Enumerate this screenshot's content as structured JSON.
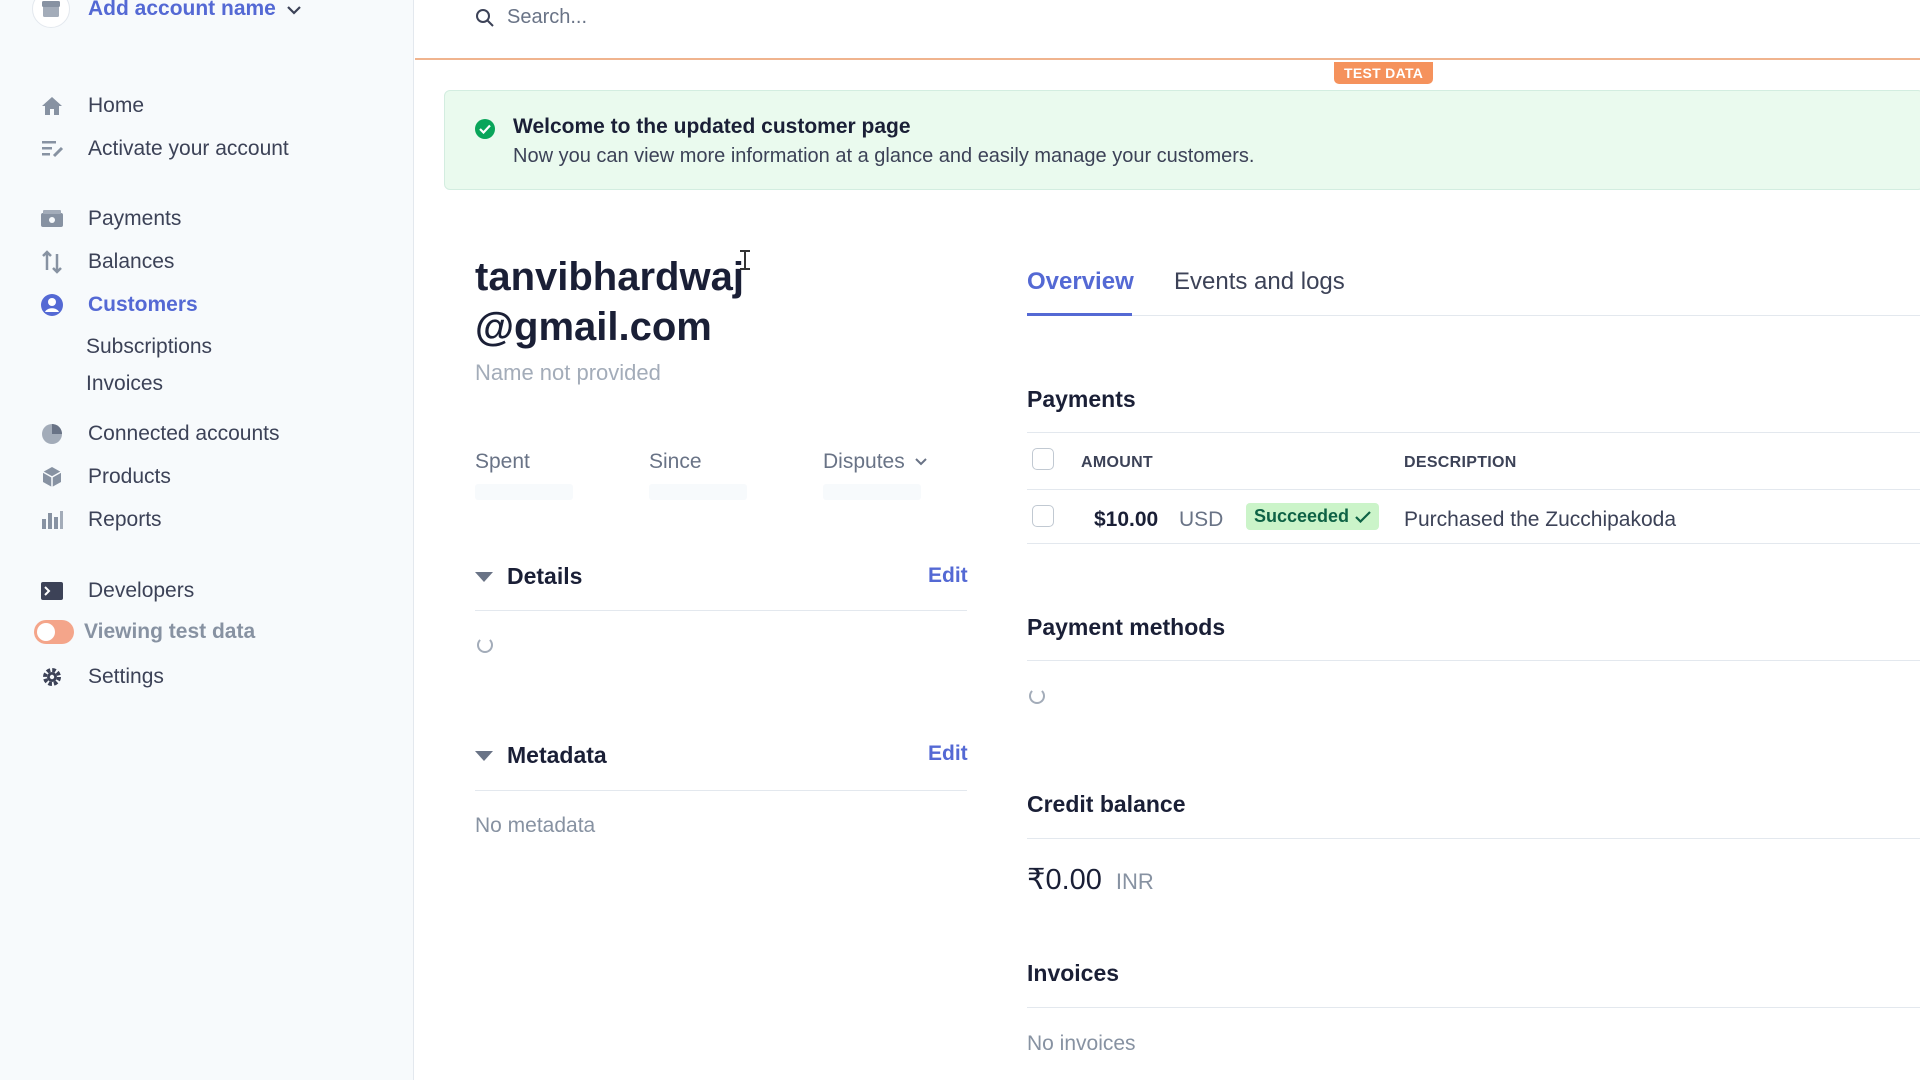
{
  "sidebar": {
    "account_name": "Add account name",
    "items": [
      {
        "label": "Home",
        "icon": "home-icon"
      },
      {
        "label": "Activate your account",
        "icon": "checklist-icon"
      },
      {
        "label": "Payments",
        "icon": "payments-icon"
      },
      {
        "label": "Balances",
        "icon": "balances-icon"
      },
      {
        "label": "Customers",
        "icon": "customers-icon",
        "active": true
      },
      {
        "label": "Subscriptions"
      },
      {
        "label": "Invoices"
      },
      {
        "label": "Connected accounts",
        "icon": "connected-accounts-icon"
      },
      {
        "label": "Products",
        "icon": "products-icon"
      },
      {
        "label": "Reports",
        "icon": "reports-icon"
      },
      {
        "label": "Developers",
        "icon": "terminal-icon"
      },
      {
        "label": "Viewing test data",
        "icon": "toggle-icon"
      },
      {
        "label": "Settings",
        "icon": "gear-icon"
      }
    ]
  },
  "search": {
    "placeholder": "Search..."
  },
  "test_badge": "TEST DATA",
  "banner": {
    "title": "Welcome to the updated customer page",
    "text": "Now you can view more information at a glance and easily manage your customers."
  },
  "customer": {
    "email_line1": "tanvibhardwaj",
    "email_line2": "@gmail.com",
    "name": "Name not provided",
    "stats": {
      "spent": "Spent",
      "since": "Since",
      "disputes": "Disputes"
    }
  },
  "details": {
    "title": "Details",
    "edit": "Edit"
  },
  "metadata": {
    "title": "Metadata",
    "edit": "Edit",
    "empty": "No metadata"
  },
  "tabs": [
    {
      "label": "Overview"
    },
    {
      "label": "Events and logs"
    }
  ],
  "payments": {
    "title": "Payments",
    "headers": {
      "amount": "AMOUNT",
      "description": "DESCRIPTION"
    },
    "rows": [
      {
        "amount": "$10.00",
        "currency": "USD",
        "status": "Succeeded",
        "description": "Purchased the Zucchipakoda"
      }
    ]
  },
  "payment_methods": {
    "title": "Payment methods"
  },
  "credit_balance": {
    "title": "Credit balance",
    "amount": "₹0.00",
    "currency": "INR"
  },
  "invoices": {
    "title": "Invoices",
    "empty": "No invoices"
  },
  "colors": {
    "accent": "#5469d4",
    "success": "#09a55a",
    "test_orange": "#f5925c"
  }
}
